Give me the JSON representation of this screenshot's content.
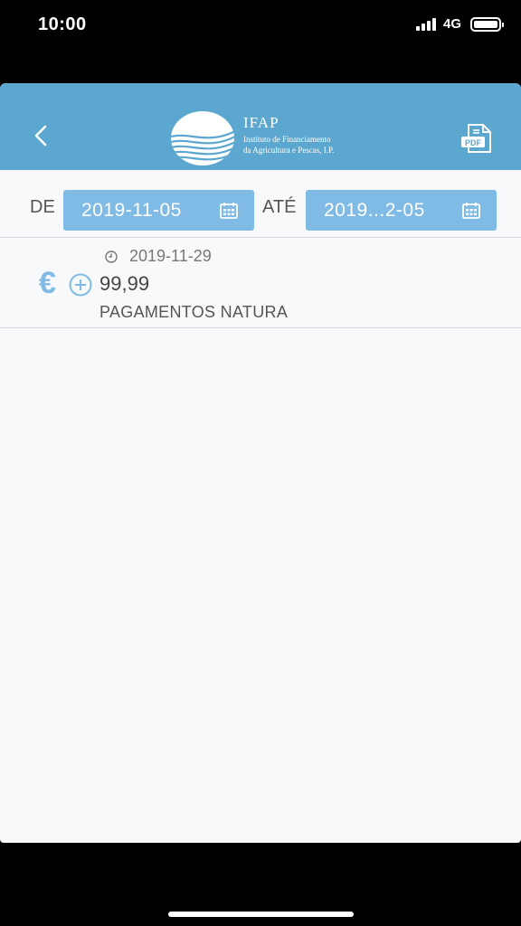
{
  "status_bar": {
    "time": "10:00",
    "network": "4G"
  },
  "header": {
    "logo_name": "IFAP",
    "logo_subtitle_line1": "Instituto de Financiamento",
    "logo_subtitle_line2": "da Agricultura e Pescas, I.P.",
    "pdf_label": "PDF",
    "accent_color": "#5ba7cf"
  },
  "filters": {
    "from_label": "DE",
    "from_value": "2019-11-05",
    "to_label": "ATÉ",
    "to_value": "2019...2-05",
    "field_color": "#7fbbe4"
  },
  "payments": [
    {
      "date": "2019-11-29",
      "amount": "99,99",
      "description": "PAGAMENTOS NATURA",
      "currency_icon": "euro-icon"
    }
  ]
}
